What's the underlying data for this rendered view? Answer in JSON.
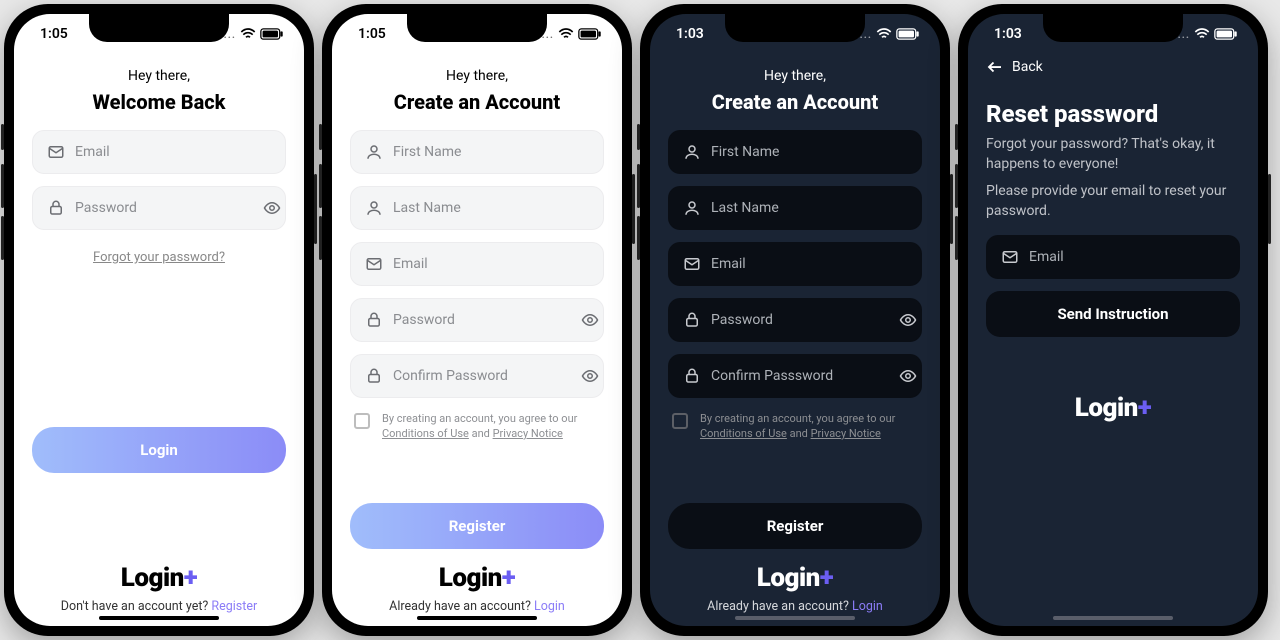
{
  "status": {
    "time_light": "1:05",
    "time_dark": "1:03",
    "dots": "....",
    "wifi_icon": "wifi",
    "battery_icon": "battery"
  },
  "common": {
    "greeting": "Hey there,"
  },
  "brand": {
    "name": "Login",
    "plus": "+"
  },
  "screen1": {
    "title": "Welcome Back",
    "email_ph": "Email",
    "password_ph": "Password",
    "forgot": "Forgot your password?",
    "login_btn": "Login",
    "noacct": "Don't have an account yet? ",
    "register_link": "Register"
  },
  "screen2": {
    "title": "Create an Account",
    "first_ph": "First Name",
    "last_ph": "Last Name",
    "email_ph": "Email",
    "password_ph": "Password",
    "confirm_ph": "Confirm Password",
    "terms_pre": "By creating an account, you agree to our ",
    "terms_cond": "Conditions of Use",
    "terms_mid": " and ",
    "terms_priv": "Privacy Notice",
    "register_btn": "Register",
    "haveacct": "Already have an account? ",
    "login_link": "Login"
  },
  "screen3": {
    "title": "Create an Account",
    "first_ph": "First Name",
    "last_ph": "Last Name",
    "email_ph": "Email",
    "password_ph": "Password",
    "confirm_ph": "Confirm Passsword",
    "terms_pre": "By creating an account, you agree to our ",
    "terms_cond": "Conditions of Use",
    "terms_mid": " and ",
    "terms_priv": "Privacy Notice",
    "register_btn": "Register",
    "haveacct": "Already have an account? ",
    "login_link": "Login"
  },
  "screen4": {
    "back": "Back",
    "title": "Reset password",
    "desc1": "Forgot your password? That's okay, it happens to everyone!",
    "desc2": "Please provide your email to reset your password.",
    "email_ph": "Email",
    "cta": "Send Instruction"
  }
}
